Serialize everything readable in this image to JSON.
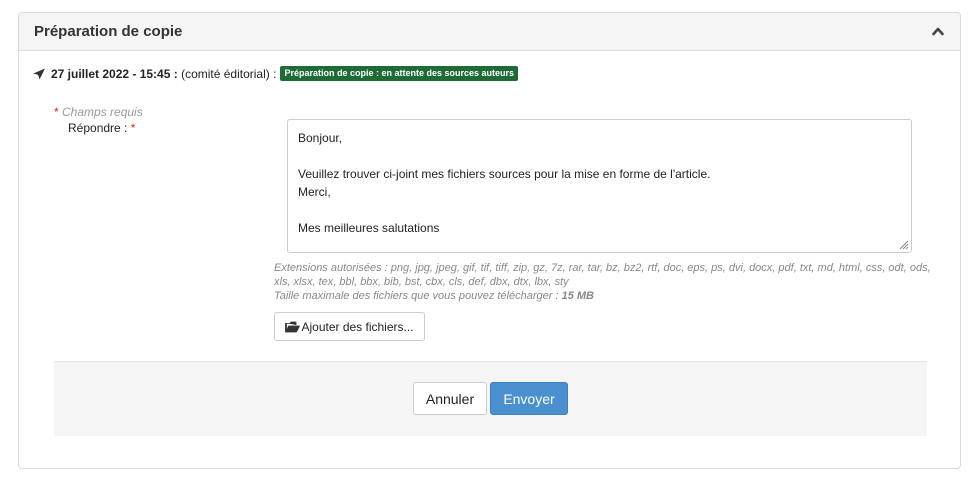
{
  "panel": {
    "title": "Préparation de copie",
    "collapse_icon": "chevron-up-icon"
  },
  "entry": {
    "icon": "send-icon",
    "datetime": "27 juillet 2022 - 15:45 :",
    "author": "(comité éditorial) :",
    "badge": "Préparation de copie : en attente des sources auteurs",
    "badge_color": "#1e6b36"
  },
  "form": {
    "required_note": "Champs requis",
    "required_star": "*",
    "reply_label": "Répondre :",
    "reply_lines": [
      "Bonjour,",
      "",
      "Veuillez trouver ci-joint mes fichiers sources pour la mise en forme de l'article.",
      "Merci,",
      "",
      "Mes meilleures salutations"
    ],
    "extensions_text": "Extensions autorisées : png, jpg, jpeg, gif, tif, tiff, zip, gz, 7z, rar, tar, bz, bz2, rtf, doc, eps, ps, dvi, docx, pdf, txt, md, html, css, odt, ods, xls, xlsx, tex, bbl, bbx, bib, bst, cbx, cls, def, dbx, dtx, lbx, sty",
    "max_size_label": "Taille maximale des fichiers que vous pouvez télécharger :",
    "max_size_value": "15 MB",
    "add_files_label": "Ajouter des fichiers...",
    "add_files_icon": "folder-open-icon"
  },
  "actions": {
    "cancel_label": "Annuler",
    "send_label": "Envoyer",
    "send_color": "#4a90cf"
  }
}
